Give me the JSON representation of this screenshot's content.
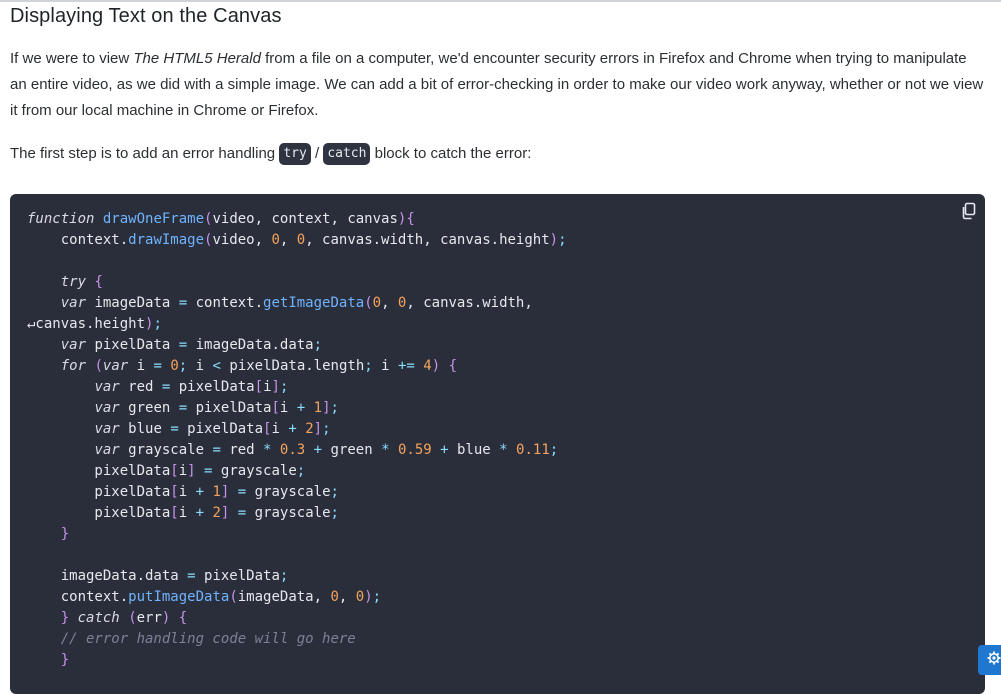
{
  "heading": "Displaying Text on the Canvas",
  "paragraph1": {
    "before": "If we were to view ",
    "emphasis": "The HTML5 Herald",
    "after": " from a file on a computer, we'd encounter security errors in Firefox and Chrome when trying to manipulate an entire video, as we did with a simple image. We can add a bit of error-checking in order to make our video work anyway, whether or not we view it from our local machine in Chrome or Firefox."
  },
  "paragraph2": {
    "before": "The first step is to add an error handling ",
    "code1": "try",
    "separator": " / ",
    "code2": "catch",
    "after": " block to catch the error:"
  },
  "code": {
    "copy_icon": "copy-icon",
    "lines": [
      "function drawOneFrame(video, context, canvas){",
      "    context.drawImage(video, 0, 0, canvas.width, canvas.height);",
      "",
      "    try {",
      "    var imageData = context.getImageData(0, 0, canvas.width,",
      "↵canvas.height);",
      "    var pixelData = imageData.data;",
      "    for (var i = 0; i < pixelData.length; i += 4) {",
      "        var red = pixelData[i];",
      "        var green = pixelData[i + 1];",
      "        var blue = pixelData[i + 2];",
      "        var grayscale = red * 0.3 + green * 0.59 + blue * 0.11;",
      "        pixelData[i] = grayscale;",
      "        pixelData[i + 1] = grayscale;",
      "        pixelData[i + 2] = grayscale;",
      "    }",
      "",
      "    imageData.data = pixelData;",
      "    context.putImageData(imageData, 0, 0);",
      "    } catch (err) {",
      "    // error handling code will go here",
      "    }"
    ]
  },
  "settings_icon": "gear-icon",
  "colors": {
    "code_bg": "#2a2e3a",
    "settings_bg": "#1f77d0"
  }
}
